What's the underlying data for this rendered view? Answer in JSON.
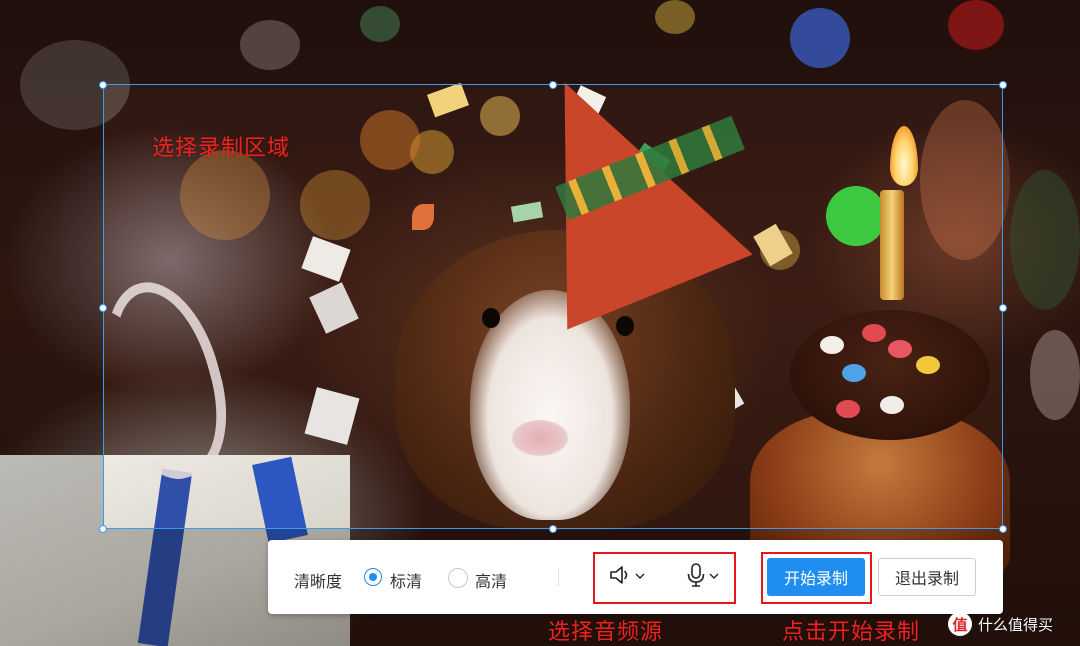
{
  "annotations": {
    "select_area": "选择录制区域",
    "select_audio": "选择音频源",
    "click_start": "点击开始录制"
  },
  "toolbar": {
    "quality_label": "清晰度",
    "quality_options": [
      {
        "label": "标清",
        "selected": true
      },
      {
        "label": "高清",
        "selected": false
      }
    ],
    "speaker_icon": "speaker-icon",
    "microphone_icon": "microphone-icon",
    "start_button": "开始录制",
    "exit_button": "退出录制"
  },
  "watermark": {
    "logo_char": "值",
    "text": "什么值得买"
  },
  "colors": {
    "accent": "#1f8ef0",
    "annotation_red": "#f3201f",
    "highlight_box": "#e5171b",
    "selection_border": "#3a9bf0"
  }
}
